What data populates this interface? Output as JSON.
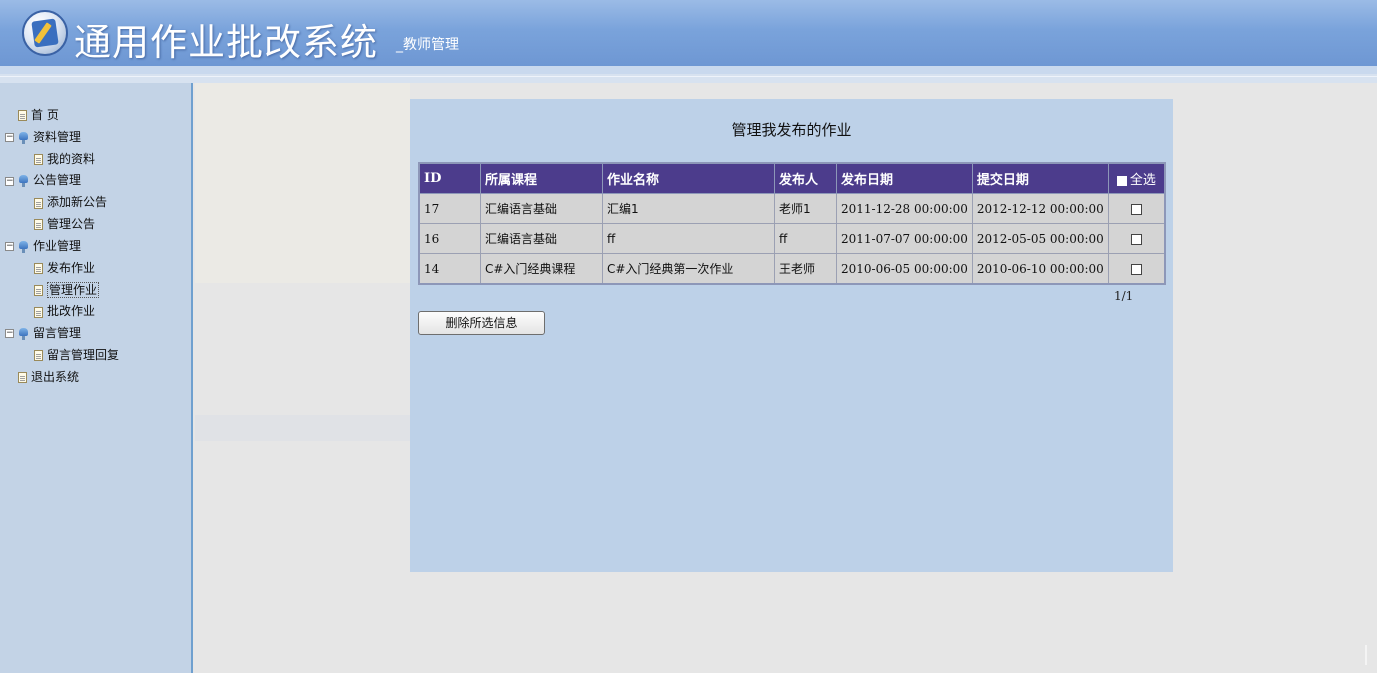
{
  "header": {
    "title": "通用作业批改系统",
    "subtitle": "_教师管理"
  },
  "sidebar": {
    "items": [
      {
        "label": "首 页",
        "type": "doc",
        "level": "top"
      },
      {
        "label": "资料管理",
        "type": "folder",
        "level": 0
      },
      {
        "label": "我的资料",
        "type": "doc",
        "level": 1
      },
      {
        "label": "公告管理",
        "type": "folder",
        "level": 0
      },
      {
        "label": "添加新公告",
        "type": "doc",
        "level": 1
      },
      {
        "label": "管理公告",
        "type": "doc",
        "level": 1
      },
      {
        "label": "作业管理",
        "type": "folder",
        "level": 0
      },
      {
        "label": "发布作业",
        "type": "doc",
        "level": 1
      },
      {
        "label": "管理作业",
        "type": "doc",
        "level": 1,
        "active": true
      },
      {
        "label": "批改作业",
        "type": "doc",
        "level": 1
      },
      {
        "label": "留言管理",
        "type": "folder",
        "level": 0
      },
      {
        "label": "留言管理回复",
        "type": "doc",
        "level": 1
      },
      {
        "label": "退出系统",
        "type": "doc",
        "level": "top"
      }
    ]
  },
  "main": {
    "title": "管理我发布的作业",
    "table": {
      "columns": [
        "ID",
        "所属课程",
        "作业名称",
        "发布人",
        "发布日期",
        "提交日期"
      ],
      "select_all_label": "全选",
      "rows": [
        {
          "id": "17",
          "course": "汇编语言基础",
          "name": "汇编1",
          "publisher": "老师1",
          "publish_date": "2011-12-28 00:00:00",
          "submit_date": "2012-12-12 00:00:00"
        },
        {
          "id": "16",
          "course": "汇编语言基础",
          "name": "ff",
          "publisher": "ff",
          "publish_date": "2011-07-07 00:00:00",
          "submit_date": "2012-05-05 00:00:00"
        },
        {
          "id": "14",
          "course": "C#入门经典课程",
          "name": "C#入门经典第一次作业",
          "publisher": "王老师",
          "publish_date": "2010-06-05 00:00:00",
          "submit_date": "2010-06-10 00:00:00"
        }
      ]
    },
    "pager": "1/1",
    "delete_button": "删除所选信息"
  },
  "colors": {
    "header_bg": "#7aa3db",
    "sidebar_bg": "#c3d3e6",
    "panel_bg": "#bdd1e8",
    "table_header_bg": "#4c3c8c"
  }
}
